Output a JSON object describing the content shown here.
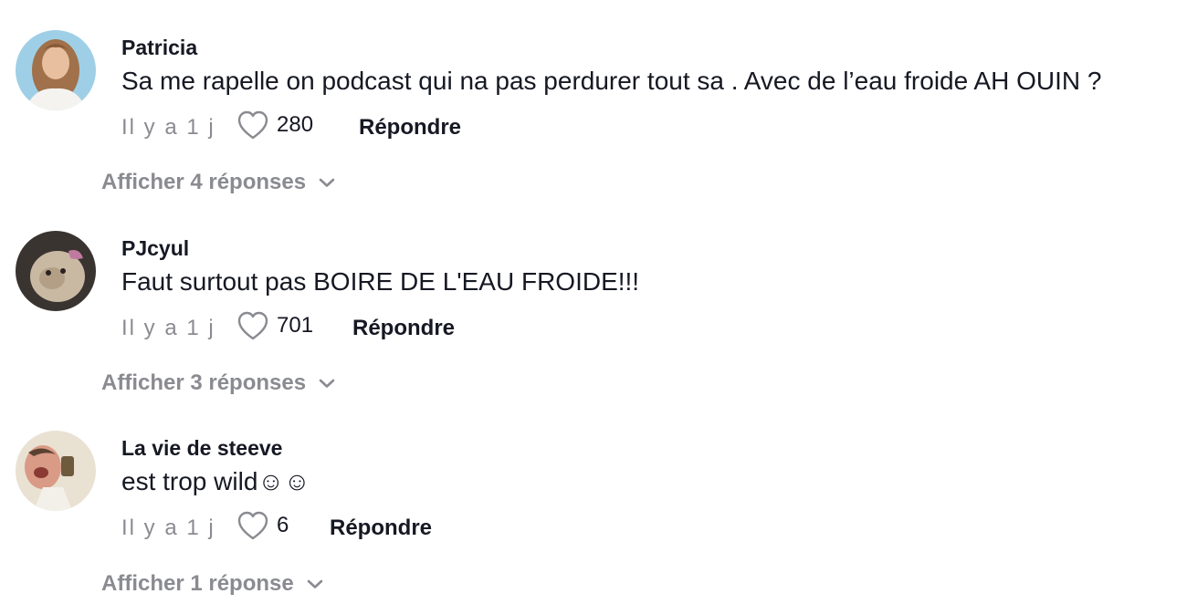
{
  "comments": [
    {
      "username": "Patricia",
      "text": "Sa me rapelle on podcast qui na pas perdurer tout sa . Avec de l’eau froide AH OUIN ?",
      "time": "Il y a 1 j",
      "likes": "280",
      "reply_label": "Répondre",
      "view_replies": "Afficher 4 réponses"
    },
    {
      "username": "PJcyul",
      "text": "Faut surtout pas BOIRE DE L'EAU FROIDE!!!",
      "time": "Il y a 1 j",
      "likes": "701",
      "reply_label": "Répondre",
      "view_replies": "Afficher 3 réponses"
    },
    {
      "username": "La vie de steeve",
      "text": "est trop wild☺☺",
      "time": "Il y a 1 j",
      "likes": "6",
      "reply_label": "Répondre",
      "view_replies": "Afficher 1 réponse"
    }
  ],
  "icons": {
    "like": "heart-outline-icon",
    "expand": "chevron-down-icon"
  }
}
